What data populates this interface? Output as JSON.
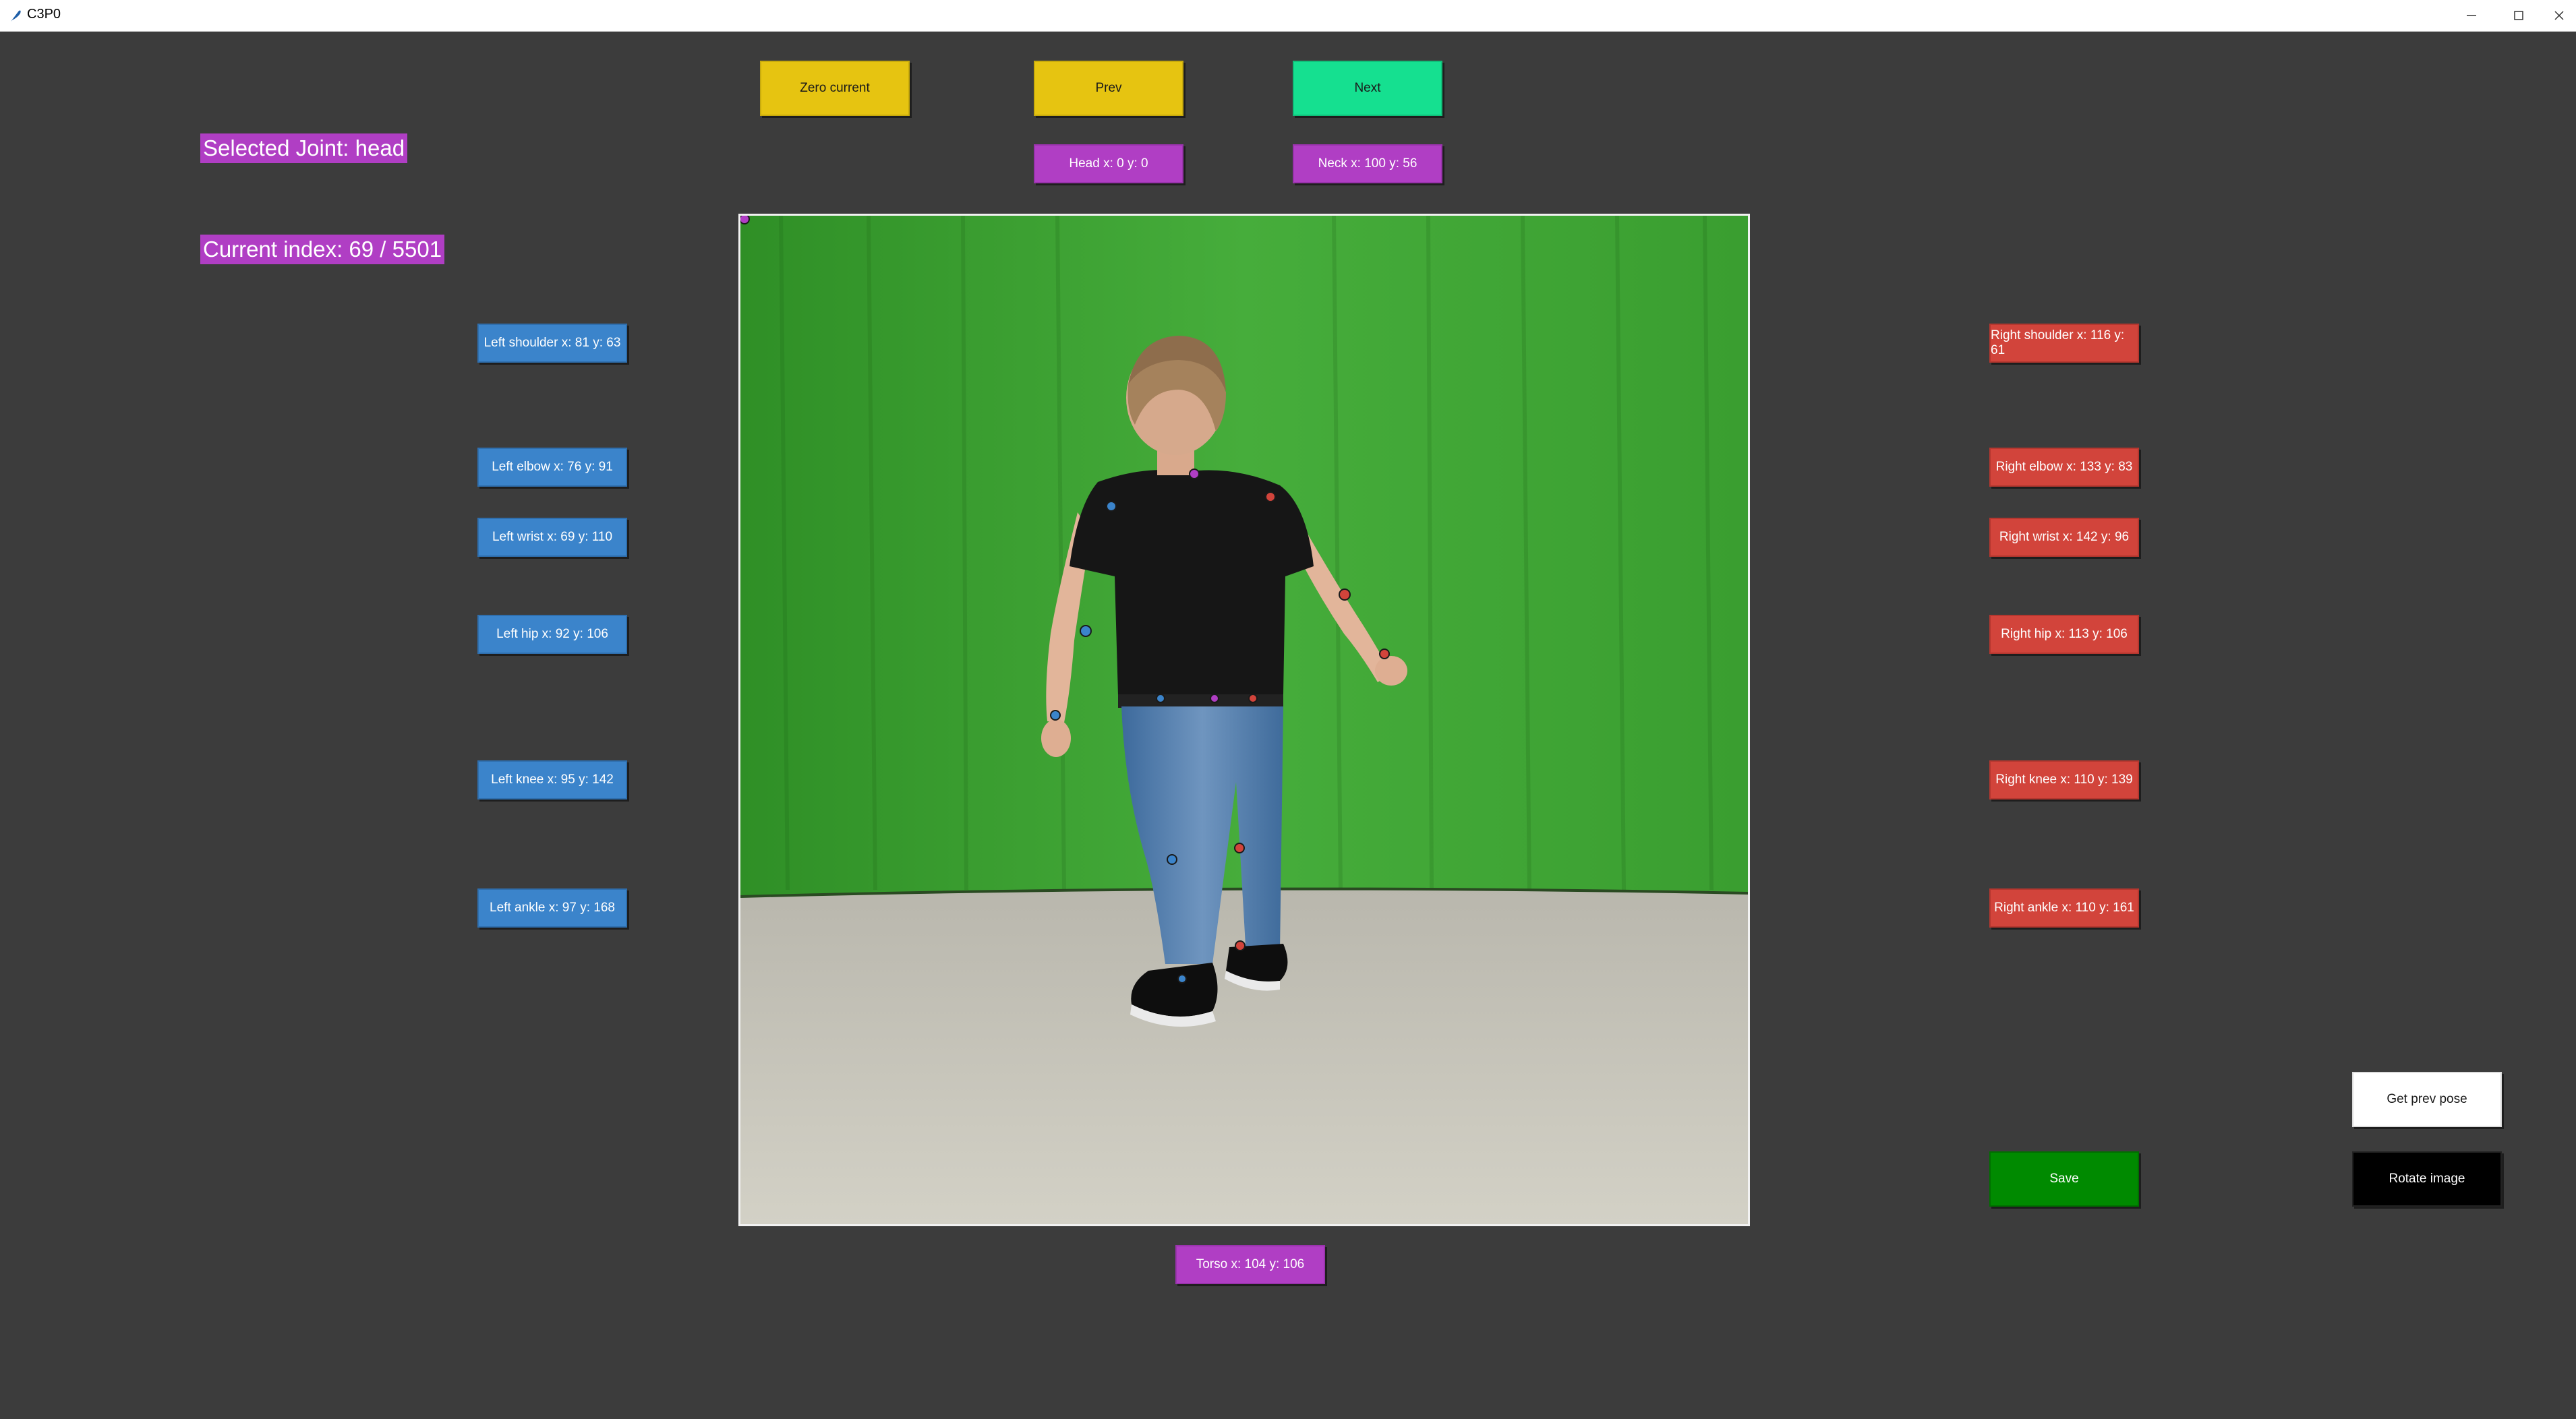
{
  "window": {
    "title": "C3P0"
  },
  "status": {
    "selected_joint": "Selected Joint: head",
    "current_index": "Current index: 69 / 5501"
  },
  "controls": {
    "zero_current": "Zero current",
    "prev": "Prev",
    "next": "Next",
    "get_prev_pose": "Get prev pose",
    "save": "Save",
    "rotate_image": "Rotate image"
  },
  "joints": {
    "head": "Head x: 0 y: 0",
    "neck": "Neck x: 100 y: 56",
    "torso": "Torso x: 104 y: 106",
    "left_shoulder": "Left shoulder x: 81 y: 63",
    "left_elbow": "Left elbow x: 76 y: 91",
    "left_wrist": "Left wrist x: 69 y: 110",
    "left_hip": "Left hip x: 92 y: 106",
    "left_knee": "Left knee x: 95 y: 142",
    "left_ankle": "Left ankle x: 97 y: 168",
    "right_shoulder": "Right shoulder x: 116 y: 61",
    "right_elbow": "Right elbow x: 133 y: 83",
    "right_wrist": "Right wrist x: 142 y: 96",
    "right_hip": "Right hip x: 113 y: 106",
    "right_knee": "Right knee x: 110 y: 139",
    "right_ankle": "Right ankle x: 110 y: 161"
  },
  "colors": {
    "background": "#3c3c3c",
    "purple": "#b03ec4",
    "yellow": "#e6c411",
    "teal": "#15e090",
    "blue": "#3b84cb",
    "red": "#d2443b",
    "green": "#008a00"
  },
  "icons": {
    "app": "feather-icon",
    "minimize": "minimize-icon",
    "maximize": "maximize-icon",
    "close": "close-icon"
  }
}
